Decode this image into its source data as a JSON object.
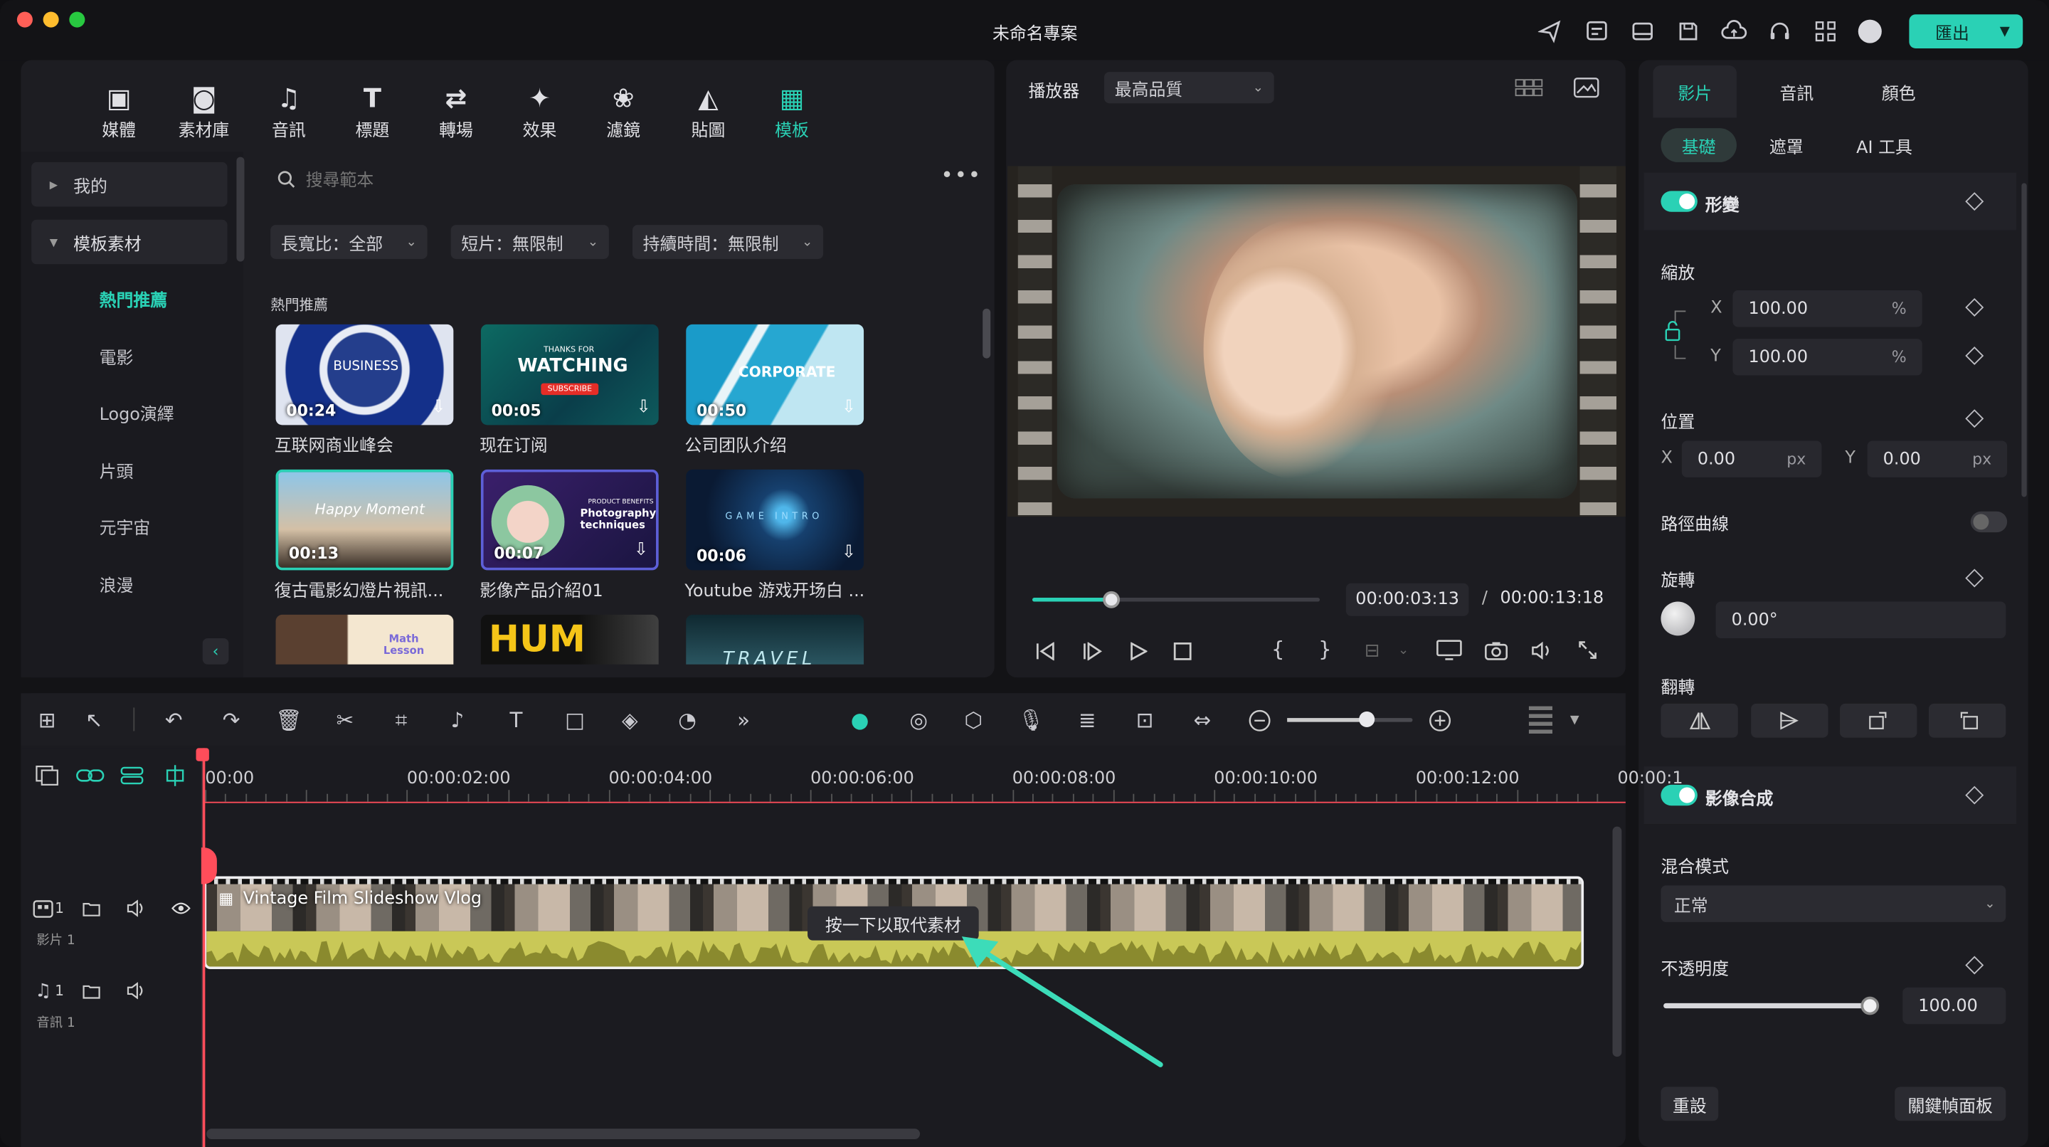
{
  "window": {
    "title": "未命名專案",
    "export_label": "匯出"
  },
  "media_tabs": [
    {
      "label": "媒體",
      "icon": "media-icon"
    },
    {
      "label": "素材庫",
      "icon": "stock-icon"
    },
    {
      "label": "音訊",
      "icon": "music-icon"
    },
    {
      "label": "標題",
      "icon": "title-icon"
    },
    {
      "label": "轉場",
      "icon": "transition-icon"
    },
    {
      "label": "效果",
      "icon": "effects-icon"
    },
    {
      "label": "濾鏡",
      "icon": "filters-icon"
    },
    {
      "label": "貼圖",
      "icon": "stickers-icon"
    },
    {
      "label": "模板",
      "icon": "templates-icon"
    }
  ],
  "active_tab": "模板",
  "sidebar": {
    "mine": "我的",
    "templates": "模板素材",
    "items": [
      "熱門推薦",
      "電影",
      "Logo演繹",
      "片頭",
      "元宇宙",
      "浪漫"
    ]
  },
  "search": {
    "placeholder": "搜尋範本"
  },
  "filters": {
    "aspect": "長寬比：全部",
    "shorts": "短片：無限制",
    "duration": "持續時間：無限制"
  },
  "section_title": "熱門推薦",
  "templates": [
    {
      "title": "互联网商业峰会",
      "duration": "00:24",
      "text": "BUSINESS"
    },
    {
      "title": "现在订阅",
      "duration": "00:05",
      "text": "WATCHING",
      "small": "THANKS FOR",
      "badge": "SUBSCRIBE"
    },
    {
      "title": "公司团队介绍",
      "duration": "00:50",
      "text": "CORPORATE"
    },
    {
      "title": "復古電影幻燈片視訊...",
      "duration": "00:13",
      "text": "Happy Moment"
    },
    {
      "title": "影像产品介紹01",
      "duration": "00:07",
      "text": "Photography techniques",
      "small": "PRODUCT BENEFITS"
    },
    {
      "title": "Youtube 游戏开场白 ...",
      "duration": "00:06",
      "text": "GAME INTRO"
    },
    {
      "title": "",
      "duration": "",
      "text": "Math Lesson"
    },
    {
      "title": "",
      "duration": "",
      "text": "HUM"
    },
    {
      "title": "",
      "duration": "",
      "text": "TRAVEL"
    }
  ],
  "player": {
    "label": "播放器",
    "quality": "最高品質",
    "current_time": "00:00:03:13",
    "total_time": "00:00:13:18",
    "progress": 0.27
  },
  "properties": {
    "tabs": [
      "影片",
      "音訊",
      "顏色"
    ],
    "subtabs": [
      "基礎",
      "遮罩",
      "AI 工具"
    ],
    "transform": "形變",
    "scale": "縮放",
    "scale_x": "100.00",
    "scale_y": "100.00",
    "percent": "%",
    "x_label": "X",
    "y_label": "Y",
    "position": "位置",
    "pos_x": "0.00",
    "pos_y": "0.00",
    "px": "px",
    "path_curve": "路徑曲線",
    "rotate": "旋轉",
    "rotate_value": "0.00°",
    "flip": "翻轉",
    "compositing": "影像合成",
    "blend_mode": "混合模式",
    "blend_value": "正常",
    "opacity": "不透明度",
    "opacity_value": "100.00",
    "opacity_level": 1.0,
    "reset": "重設",
    "keyframe_panel": "關鍵幀面板"
  },
  "timeline": {
    "ruler": [
      "00:00",
      "00:00:02:00",
      "00:00:04:00",
      "00:00:06:00",
      "00:00:08:00",
      "00:00:10:00",
      "00:00:12:00",
      "00:00:1"
    ],
    "clip_title": "Vintage Film Slideshow Vlog",
    "tooltip": "按一下以取代素材",
    "video_track": "影片 1",
    "audio_track": "音訊 1",
    "video_num": "1",
    "audio_num": "1"
  },
  "colors": {
    "accent": "#2ad1b5",
    "playhead": "#ff4d5a",
    "waveform": "#c9c857"
  }
}
